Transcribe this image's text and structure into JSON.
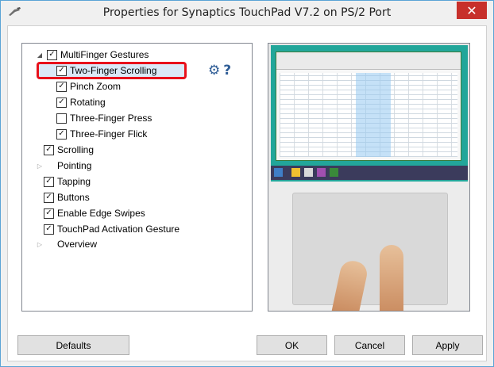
{
  "window": {
    "title": "Properties for Synaptics TouchPad V7.2 on PS/2 Port",
    "close_glyph": "✕",
    "accent": "#c7302b"
  },
  "tree": {
    "items": [
      {
        "label": "MultiFinger Gestures",
        "checked": true,
        "expander": "expanded"
      },
      {
        "label": "Two-Finger Scrolling",
        "checked": true,
        "selected": true
      },
      {
        "label": "Pinch Zoom",
        "checked": true
      },
      {
        "label": "Rotating",
        "checked": true
      },
      {
        "label": "Three-Finger Press",
        "checked": false
      },
      {
        "label": "Three-Finger Flick",
        "checked": true
      },
      {
        "label": "Scrolling",
        "checked": true
      },
      {
        "label": "Pointing",
        "checked": null,
        "expander": "collapsed"
      },
      {
        "label": "Tapping",
        "checked": true
      },
      {
        "label": "Buttons",
        "checked": true
      },
      {
        "label": "Enable Edge Swipes",
        "checked": true
      },
      {
        "label": "TouchPad Activation Gesture",
        "checked": true
      },
      {
        "label": "Overview",
        "checked": null,
        "expander": "collapsed"
      }
    ],
    "settings_icon": "gears-icon",
    "help_icon": "question-icon",
    "help_glyph": "?",
    "settings_glyph": "⚙"
  },
  "buttons": {
    "defaults": "Defaults",
    "ok": "OK",
    "cancel": "Cancel",
    "apply": "Apply"
  },
  "preview": {
    "description_icon": "touchpad-animation-preview"
  },
  "colors": {
    "highlight_border": "#e8111b",
    "selection_bg": "#dbe9f7"
  }
}
